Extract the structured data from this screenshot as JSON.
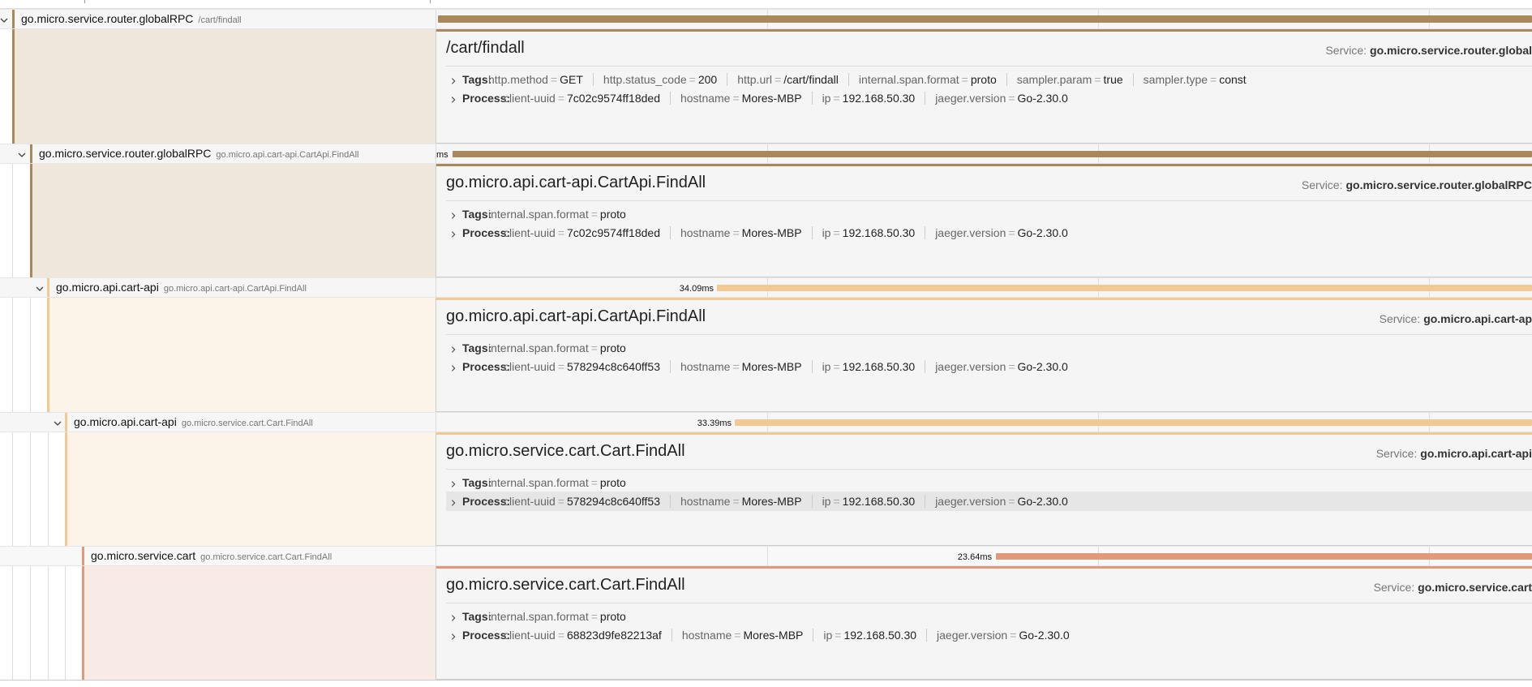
{
  "spans": [
    {
      "row_name": "go.micro.service.router.globalRPC",
      "row_op": "/cart/findall",
      "duration": "",
      "color": "#a9885c",
      "detail": {
        "title": "/cart/findall",
        "service_label": "Service:",
        "service_name": "go.micro.service.router.global",
        "tags_label": "Tags:",
        "tags": [
          {
            "k": "http.method",
            "v": "GET"
          },
          {
            "k": "http.status_code",
            "v": "200"
          },
          {
            "k": "http.url",
            "v": "/cart/findall"
          },
          {
            "k": "internal.span.format",
            "v": "proto"
          },
          {
            "k": "sampler.param",
            "v": "true"
          },
          {
            "k": "sampler.type",
            "v": "const"
          }
        ],
        "process_label": "Process:",
        "process": [
          {
            "k": "client-uuid",
            "v": "7c02c9574ff18ded"
          },
          {
            "k": "hostname",
            "v": "Mores-MBP"
          },
          {
            "k": "ip",
            "v": "192.168.50.30"
          },
          {
            "k": "jaeger.version",
            "v": "Go-2.30.0"
          }
        ]
      }
    },
    {
      "row_name": "go.micro.service.router.globalRPC",
      "row_op": "go.micro.api.cart-api.CartApi.FindAll",
      "duration": "ms",
      "color": "#a9885c",
      "detail": {
        "title": "go.micro.api.cart-api.CartApi.FindAll",
        "service_label": "Service:",
        "service_name": "go.micro.service.router.globalRPC",
        "tags_label": "Tags:",
        "tags": [
          {
            "k": "internal.span.format",
            "v": "proto"
          }
        ],
        "process_label": "Process:",
        "process": [
          {
            "k": "client-uuid",
            "v": "7c02c9574ff18ded"
          },
          {
            "k": "hostname",
            "v": "Mores-MBP"
          },
          {
            "k": "ip",
            "v": "192.168.50.30"
          },
          {
            "k": "jaeger.version",
            "v": "Go-2.30.0"
          }
        ]
      }
    },
    {
      "row_name": "go.micro.api.cart-api",
      "row_op": "go.micro.api.cart-api.CartApi.FindAll",
      "duration": "34.09ms",
      "color": "#f2c992",
      "detail": {
        "title": "go.micro.api.cart-api.CartApi.FindAll",
        "service_label": "Service:",
        "service_name": "go.micro.api.cart-ap",
        "tags_label": "Tags:",
        "tags": [
          {
            "k": "internal.span.format",
            "v": "proto"
          }
        ],
        "process_label": "Process:",
        "process": [
          {
            "k": "client-uuid",
            "v": "578294c8c640ff53"
          },
          {
            "k": "hostname",
            "v": "Mores-MBP"
          },
          {
            "k": "ip",
            "v": "192.168.50.30"
          },
          {
            "k": "jaeger.version",
            "v": "Go-2.30.0"
          }
        ]
      }
    },
    {
      "row_name": "go.micro.api.cart-api",
      "row_op": "go.micro.service.cart.Cart.FindAll",
      "duration": "33.39ms",
      "color": "#f2c992",
      "detail": {
        "title": "go.micro.service.cart.Cart.FindAll",
        "service_label": "Service:",
        "service_name": "go.micro.api.cart-api",
        "tags_label": "Tags:",
        "tags": [
          {
            "k": "internal.span.format",
            "v": "proto"
          }
        ],
        "process_label": "Process:",
        "process": [
          {
            "k": "client-uuid",
            "v": "578294c8c640ff53"
          },
          {
            "k": "hostname",
            "v": "Mores-MBP"
          },
          {
            "k": "ip",
            "v": "192.168.50.30"
          },
          {
            "k": "jaeger.version",
            "v": "Go-2.30.0"
          }
        ]
      }
    },
    {
      "row_name": "go.micro.service.cart",
      "row_op": "go.micro.service.cart.Cart.FindAll",
      "duration": "23.64ms",
      "color": "#e09a7a",
      "detail": {
        "title": "go.micro.service.cart.Cart.FindAll",
        "service_label": "Service:",
        "service_name": "go.micro.service.cart",
        "tags_label": "Tags:",
        "tags": [
          {
            "k": "internal.span.format",
            "v": "proto"
          }
        ],
        "process_label": "Process:",
        "process": [
          {
            "k": "client-uuid",
            "v": "68823d9fe82213af"
          },
          {
            "k": "hostname",
            "v": "Mores-MBP"
          },
          {
            "k": "ip",
            "v": "192.168.50.30"
          },
          {
            "k": "jaeger.version",
            "v": "Go-2.30.0"
          }
        ]
      }
    }
  ],
  "icons": {
    "expand": "chevron-down-icon",
    "section": "chevron-right-icon"
  }
}
